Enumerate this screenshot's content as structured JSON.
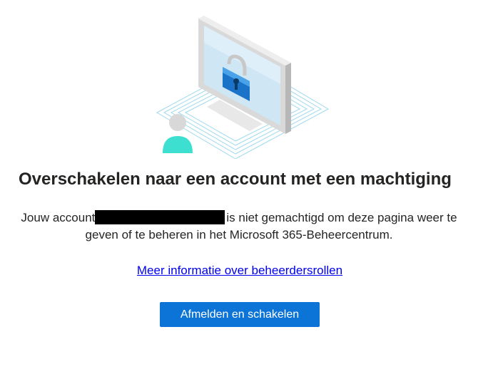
{
  "illustration": {
    "icon_name": "account-lock-illustration",
    "accent_color": "#0f6cbd",
    "person_color": "#3de0d0"
  },
  "header": {
    "title": "Overschakelen naar een account met een machtiging"
  },
  "message": {
    "prefix": "Jouw account",
    "suffix": "is niet gemachtigd om deze pagina weer te geven of te beheren in het Microsoft 365-Beheercentrum."
  },
  "links": {
    "more_info": "Meer informatie over beheerdersrollen"
  },
  "actions": {
    "sign_out_switch": "Afmelden en schakelen",
    "button_color": "#0b74d6"
  }
}
